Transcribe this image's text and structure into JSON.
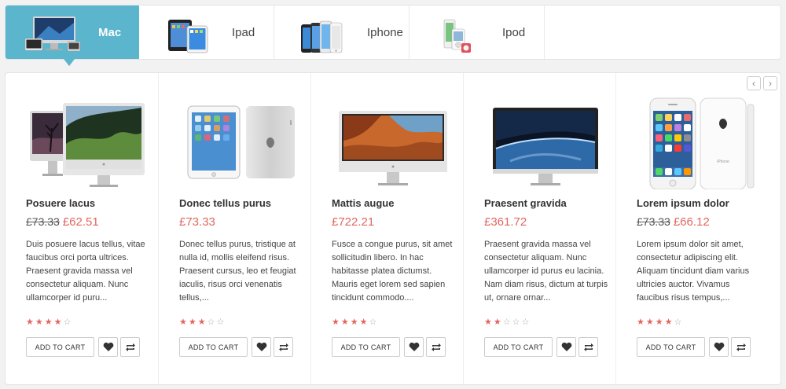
{
  "tabs": [
    {
      "label": "Mac",
      "icon": "imac-icon",
      "active": true
    },
    {
      "label": "Ipad",
      "icon": "ipad-icon",
      "active": false
    },
    {
      "label": "Iphone",
      "icon": "iphone-icon",
      "active": false
    },
    {
      "label": "Ipod",
      "icon": "ipod-icon",
      "active": false
    }
  ],
  "nav": {
    "prev": "‹",
    "next": "›"
  },
  "colors": {
    "accent": "#5bb5cc",
    "sale": "#e0675f"
  },
  "products": [
    {
      "name": "Posuere lacus",
      "old_price": "£73.33",
      "price": "£62.51",
      "description": "Duis posuere lacus tellus, vitae faucibus orci porta ultrices. Praesent gravida massa vel consectetur aliquam. Nunc ullamcorper id puru...",
      "rating": 4,
      "cart_label": "ADD TO CART",
      "image": "imac-pair-image"
    },
    {
      "name": "Donec tellus purus",
      "old_price": "",
      "price": "£73.33",
      "description": "Donec tellus purus, tristique at nulla id, mollis eleifend risus. Praesent cursus, leo et feugiat iaculis, risus orci venenatis tellus,...",
      "rating": 3,
      "cart_label": "ADD TO CART",
      "image": "ipad-image"
    },
    {
      "name": "Mattis augue",
      "old_price": "",
      "price": "£722.21",
      "description": "Fusce a congue purus, sit amet sollicitudin libero. In hac habitasse platea dictumst. Mauris eget lorem sed sapien tincidunt commodo....",
      "rating": 4,
      "cart_label": "ADD TO CART",
      "image": "imac-image"
    },
    {
      "name": "Praesent gravida",
      "old_price": "",
      "price": "£361.72",
      "description": "Praesent gravida massa vel consectetur aliquam. Nunc ullamcorper id purus eu lacinia. Nam diam risus, dictum at turpis ut, ornare ornar...",
      "rating": 2,
      "cart_label": "ADD TO CART",
      "image": "cinema-display-image"
    },
    {
      "name": "Lorem ipsum dolor",
      "old_price": "£73.33",
      "price": "£66.12",
      "description": "Lorem ipsum dolor sit amet, consectetur adipiscing elit. Aliquam tincidunt diam varius ultricies auctor. Vivamus faucibus risus tempus,...",
      "rating": 4,
      "cart_label": "ADD TO CART",
      "image": "iphone-5c-image"
    }
  ]
}
